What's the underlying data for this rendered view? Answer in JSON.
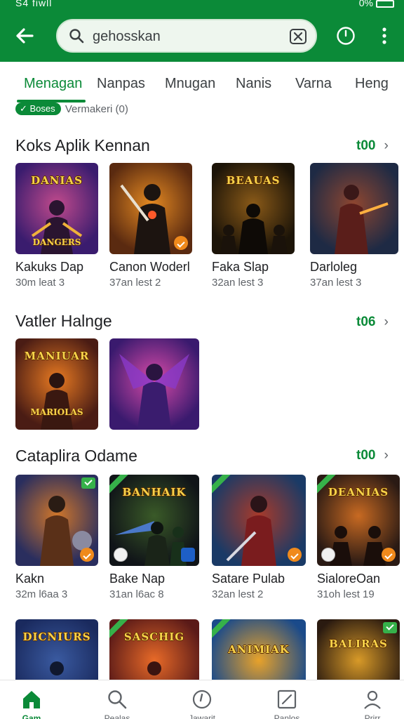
{
  "status_bar": {
    "left": "S4 fiwll",
    "right": "0%"
  },
  "search": {
    "value": "gehosskan",
    "placeholder": ""
  },
  "tabs": [
    {
      "label": "Menagan",
      "active": true
    },
    {
      "label": "Nanpas"
    },
    {
      "label": "Mnugan"
    },
    {
      "label": "Nanis"
    },
    {
      "label": "Varna"
    },
    {
      "label": "Heng"
    }
  ],
  "filter": {
    "chip": "Boses",
    "text": "Vermakeri (0)"
  },
  "sections": [
    {
      "title": "Koks Aplik Kennan",
      "more": "t00",
      "cards": [
        {
          "name": "Kakuks Dap",
          "meta": "30m leat 3",
          "art_title": "DANIAS",
          "art_sub": "DANGERS",
          "colors": [
            "#3a1c6e",
            "#c04a8c"
          ]
        },
        {
          "name": "Canon Woderl",
          "meta": "37an lest 2",
          "art_title": "",
          "art_sub": "",
          "colors": [
            "#5a2a10",
            "#e58a22"
          ]
        },
        {
          "name": "Faka Slap",
          "meta": "32an lest 3",
          "art_title": "BEAUAS",
          "art_sub": "",
          "colors": [
            "#1c1408",
            "#8a5a18"
          ]
        },
        {
          "name": "Darloleg",
          "meta": "37an lest 3",
          "art_title": "",
          "art_sub": "",
          "colors": [
            "#1e2a44",
            "#8e4630"
          ]
        }
      ]
    },
    {
      "title": "Vatler Halnge",
      "more": "t06",
      "cards": [
        {
          "name": "",
          "meta": "",
          "art_title": "MANIUAR",
          "art_sub": "MARIOLAS",
          "colors": [
            "#4a1c14",
            "#e87a22"
          ]
        },
        {
          "name": "",
          "meta": "",
          "art_title": "",
          "art_sub": "",
          "colors": [
            "#3a1a6e",
            "#d84aa8"
          ]
        }
      ]
    },
    {
      "title": "Cataplira Odame",
      "more": "t00",
      "cards": [
        {
          "name": "Kakn",
          "meta": "32m l6aa 3",
          "art_title": "",
          "art_sub": "",
          "colors": [
            "#2a2e5e",
            "#d0762a"
          ]
        },
        {
          "name": "Bake Nap",
          "meta": "31an l6ac 8",
          "art_title": "BANHAIK",
          "art_sub": "",
          "colors": [
            "#101418",
            "#3a5a28"
          ]
        },
        {
          "name": "Satare Pulab",
          "meta": "32an lest 2",
          "art_title": "",
          "art_sub": "",
          "colors": [
            "#1a3a66",
            "#a83a2a"
          ]
        },
        {
          "name": "SialoreOan",
          "meta": "31oh lest 19",
          "art_title": "DEANIAS",
          "art_sub": "",
          "colors": [
            "#2a1a14",
            "#c86a22"
          ]
        }
      ]
    },
    {
      "title": "",
      "more": "",
      "cards": [
        {
          "name": "",
          "meta": "",
          "art_title": "DICNIURS",
          "art_sub": "",
          "colors": [
            "#1a2a5e",
            "#3a5aa0"
          ]
        },
        {
          "name": "",
          "meta": "",
          "art_title": "SASCHIG",
          "art_sub": "",
          "colors": [
            "#5a1a18",
            "#e86a28"
          ]
        },
        {
          "name": "",
          "meta": "",
          "art_title": "ANIMIAK",
          "art_sub": "",
          "colors": [
            "#1a4a8a",
            "#e8a22a"
          ]
        },
        {
          "name": "",
          "meta": "",
          "art_title": "BALIRAS",
          "art_sub": "",
          "colors": [
            "#2a1a10",
            "#d89a28"
          ]
        }
      ]
    }
  ],
  "bottom_nav": [
    {
      "label": "Gam",
      "icon": "home-icon",
      "active": true
    },
    {
      "label": "Pealas",
      "icon": "search-icon"
    },
    {
      "label": "Jawarit",
      "icon": "clock-icon"
    },
    {
      "label": "Panlos",
      "icon": "edit-icon"
    },
    {
      "label": "Prirr",
      "icon": "person-icon"
    }
  ],
  "colors": {
    "brand": "#0b8a38",
    "text": "#202124",
    "muted": "#5f6368"
  }
}
